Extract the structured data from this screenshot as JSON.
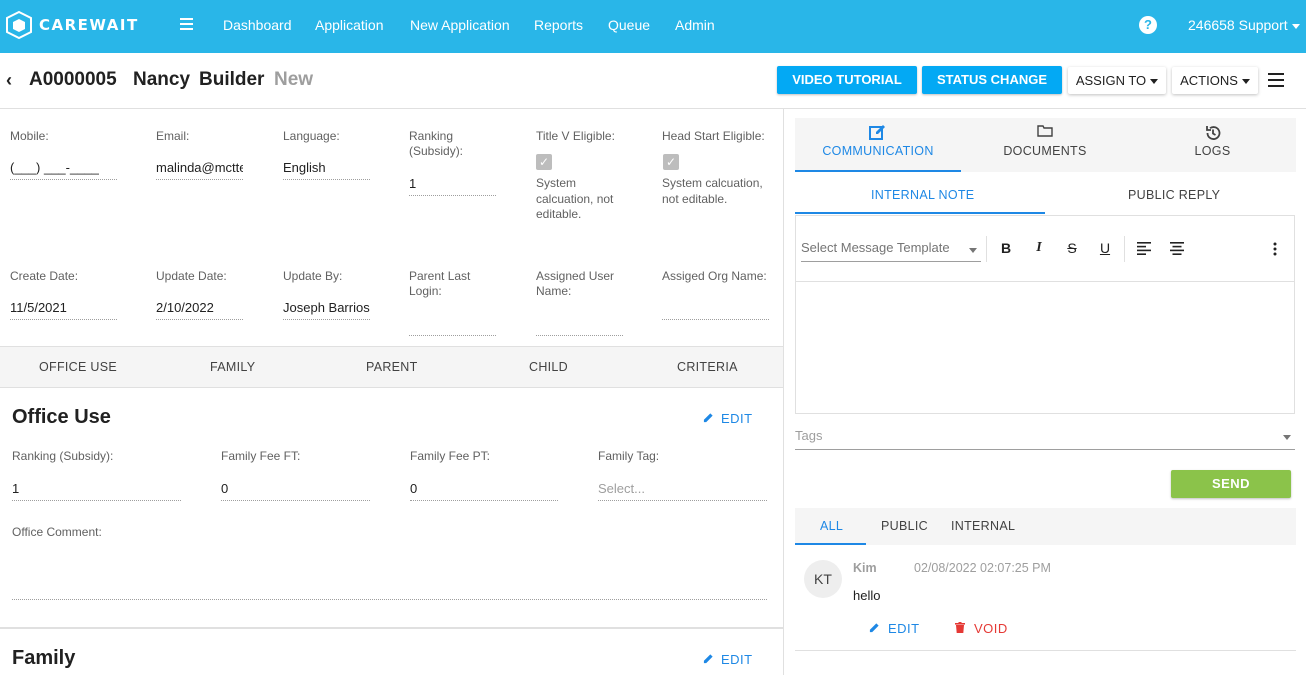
{
  "app": {
    "logo_text": "CAREWAIT",
    "user_menu": "246658 Support",
    "help_glyph": "?"
  },
  "nav": {
    "links": [
      "Dashboard",
      "Application",
      "New Application",
      "Reports",
      "Queue",
      "Admin"
    ]
  },
  "record": {
    "back_glyph": "‹",
    "id": "A0000005",
    "first_name": "Nancy",
    "last_name": "Builder",
    "status": "New"
  },
  "actions": {
    "video_tutorial": "VIDEO TUTORIAL",
    "status_change": "STATUS CHANGE",
    "assign_to": "ASSIGN TO",
    "actions": "ACTIONS"
  },
  "header_fields": {
    "mobile": {
      "label": "Mobile:",
      "value": "(___) ___-____"
    },
    "email": {
      "label": "Email:",
      "value": "malinda@mctte"
    },
    "language": {
      "label": "Language:",
      "value": "English"
    },
    "ranking": {
      "label_1": "Ranking",
      "label_2": "(Subsidy):",
      "value": "1"
    },
    "title_v": {
      "label": "Title V Eligible:",
      "note_1": "System",
      "note_2": "calcuation, not",
      "note_3": "editable."
    },
    "head_start": {
      "label": "Head Start Eligible:",
      "note_1": "System calcuation,",
      "note_2": "not editable."
    },
    "create_date": {
      "label": "Create Date:",
      "value": "11/5/2021"
    },
    "update_date": {
      "label": "Update Date:",
      "value": "2/10/2022"
    },
    "update_by": {
      "label": "Update By:",
      "value": "Joseph Barrios"
    },
    "parent_last_login": {
      "label_1": "Parent Last",
      "label_2": "Login:",
      "value": ""
    },
    "assigned_user": {
      "label_1": "Assigned User",
      "label_2": "Name:",
      "value": ""
    },
    "assigned_org": {
      "label": "Assiged Org Name:",
      "value": ""
    }
  },
  "section_tabs": [
    "OFFICE USE",
    "FAMILY",
    "PARENT",
    "CHILD",
    "CRITERIA"
  ],
  "office_use": {
    "title": "Office Use",
    "edit": "EDIT",
    "ranking": {
      "label": "Ranking (Subsidy):",
      "value": "1"
    },
    "fee_ft": {
      "label": "Family Fee FT:",
      "value": "0"
    },
    "fee_pt": {
      "label": "Family Fee PT:",
      "value": "0"
    },
    "tag": {
      "label": "Family Tag:",
      "placeholder": "Select..."
    },
    "comment": {
      "label": "Office Comment:",
      "value": ""
    }
  },
  "family": {
    "title": "Family",
    "edit": "EDIT"
  },
  "right_panel": {
    "tabs": [
      {
        "label": "COMMUNICATION",
        "icon": "edit-square-icon"
      },
      {
        "label": "DOCUMENTS",
        "icon": "folder-icon"
      },
      {
        "label": "LOGS",
        "icon": "history-icon"
      }
    ],
    "sub_tabs": [
      "INTERNAL NOTE",
      "PUBLIC REPLY"
    ],
    "template_placeholder": "Select Message Template",
    "toolbar": {
      "bold": "B",
      "italic": "I",
      "strike": "S",
      "underline": "U"
    },
    "tags_placeholder": "Tags",
    "send": "SEND",
    "filter_tabs": [
      "ALL",
      "PUBLIC",
      "INTERNAL"
    ],
    "message": {
      "initials": "KT",
      "author": "Kim",
      "timestamp": "02/08/2022 02:07:25 PM",
      "text": "hello",
      "edit": "EDIT",
      "void": "VOID"
    }
  },
  "colors": {
    "header": "#29b6e8",
    "primary": "#03a9f4",
    "accent": "#1e88e5",
    "send": "#8bc34a",
    "danger": "#e53935"
  }
}
